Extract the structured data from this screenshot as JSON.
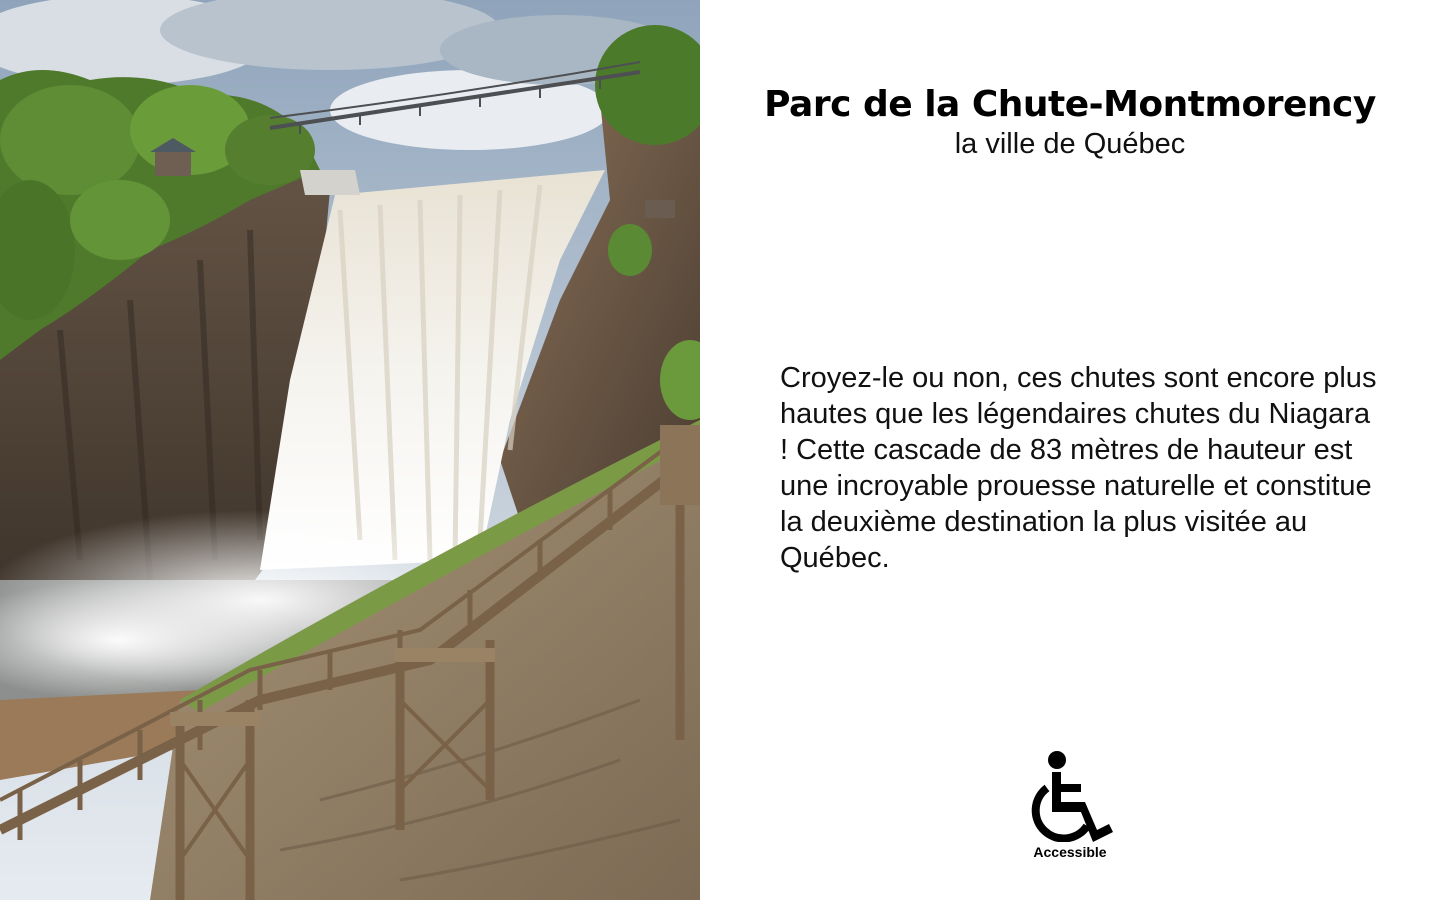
{
  "attraction": {
    "title": "Parc de la Chute-Montmorency",
    "subtitle": "la ville de Québec",
    "description": "Croyez-le ou non, ces chutes sont encore plus hautes que les légendaires chutes du Niagara ! Cette cascade de 83 mètres de hauteur est une incroyable prouesse naturelle et constitue la deuxième destination la plus visitée au Québec."
  },
  "accessibility": {
    "icon": "wheelchair-icon",
    "label": "Accessible"
  },
  "photo": {
    "subject": "waterfall-photo"
  },
  "colors": {
    "background": "#ffffff",
    "text": "#000000"
  }
}
